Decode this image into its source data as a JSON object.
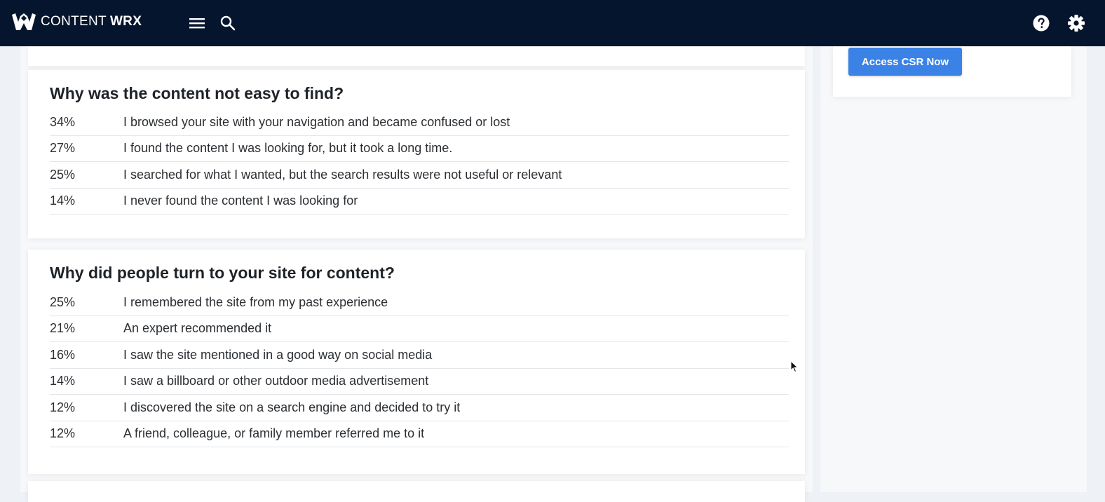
{
  "header": {
    "brand_light": "CONTENT",
    "brand_bold": "WRX",
    "logo_icon": "wrx-logo-icon",
    "menu_icon": "hamburger-menu-icon",
    "search_icon": "search-icon",
    "help_icon": "help-circle-icon",
    "settings_icon": "gear-icon"
  },
  "sidebar": {
    "cta_label": "Access CSR Now"
  },
  "sections": [
    {
      "title": "Why was the content not easy to find?",
      "rows": [
        {
          "pct": "34%",
          "text": "I browsed your site with your navigation and became confused or lost"
        },
        {
          "pct": "27%",
          "text": "I found the content I was looking for, but it took a long time."
        },
        {
          "pct": "25%",
          "text": "I searched for what I wanted, but the search results were not useful or relevant"
        },
        {
          "pct": "14%",
          "text": "I never found the content I was looking for"
        }
      ]
    },
    {
      "title": "Why did people turn to your site for content?",
      "rows": [
        {
          "pct": "25%",
          "text": "I remembered the site from my past experience"
        },
        {
          "pct": "21%",
          "text": "An expert recommended it"
        },
        {
          "pct": "16%",
          "text": "I saw the site mentioned in a good way on social media"
        },
        {
          "pct": "14%",
          "text": "I saw a billboard or other outdoor media advertisement"
        },
        {
          "pct": "12%",
          "text": "I discovered the site on a search engine and decided to try it"
        },
        {
          "pct": "12%",
          "text": "A friend, colleague, or family member referred me to it"
        }
      ]
    }
  ],
  "colors": {
    "topbar": "#06152e",
    "accent_button": "#3b82e6",
    "page_bg": "#eef1f6"
  }
}
